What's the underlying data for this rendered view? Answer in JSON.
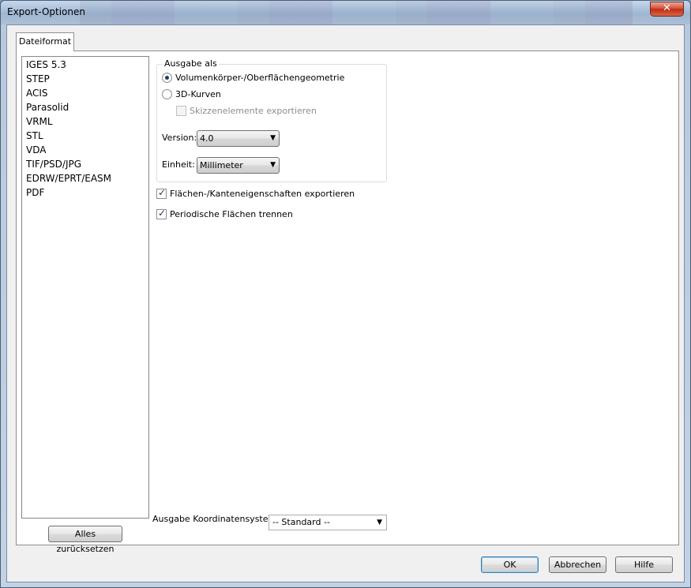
{
  "window": {
    "title": "Export-Optionen",
    "close_glyph": "✕"
  },
  "tab": {
    "label": "Dateiformat"
  },
  "format_list": {
    "items": [
      "IGES 5.3",
      "STEP",
      "ACIS",
      "Parasolid",
      "VRML",
      "STL",
      "VDA",
      "TIF/PSD/JPG",
      "EDRW/EPRT/EASM",
      "PDF"
    ],
    "selected": "ACIS"
  },
  "reset_button": "Alles zurücksetzen",
  "output_group": {
    "title": "Ausgabe als",
    "radio_solid": "Volumenkörper-/Oberflächengeometrie",
    "radio_curves": "3D-Kurven",
    "sketch_checkbox": "Skizzenelemente exportieren"
  },
  "version": {
    "label": "Version:",
    "value": "4.0"
  },
  "unit": {
    "label": "Einheit:",
    "value": "Millimeter"
  },
  "options": {
    "face_edge_props": "Flächen-/Kanteneigenschaften exportieren",
    "split_periodic": "Periodische Flächen trennen"
  },
  "coordinate_system": {
    "label": "Ausgabe Koordinatensystem:",
    "value": "-- Standard --"
  },
  "footer": {
    "ok": "OK",
    "cancel": "Abbrechen",
    "help": "Hilfe"
  }
}
